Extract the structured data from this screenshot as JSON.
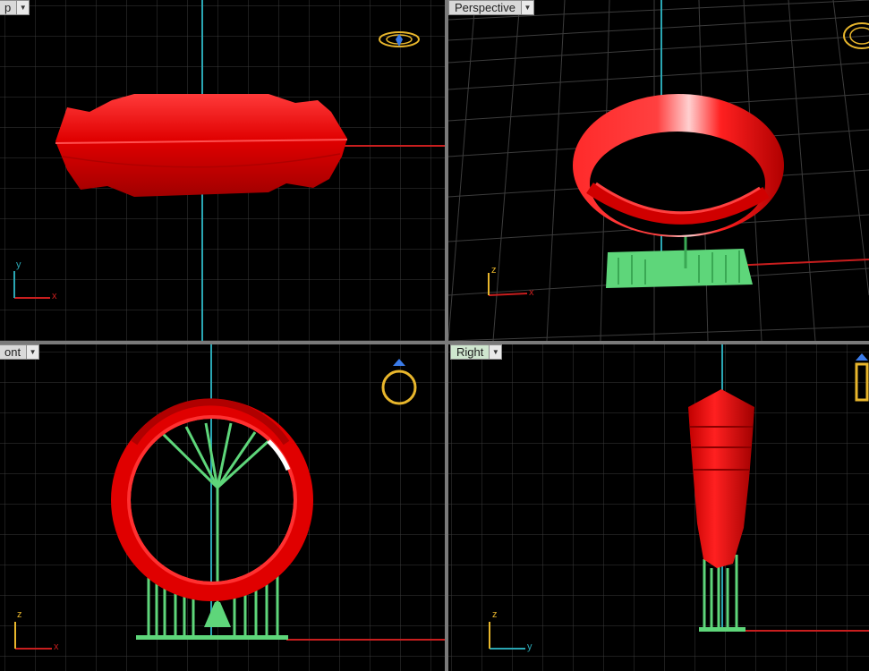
{
  "viewports": {
    "top": {
      "label": "p"
    },
    "perspective": {
      "label": "Perspective"
    },
    "front": {
      "label": "ont"
    },
    "right": {
      "label": "Right"
    }
  },
  "axes": {
    "top": {
      "a": "y",
      "b": "x"
    },
    "perspective": {
      "a": "z",
      "b": "x"
    },
    "front": {
      "a": "z",
      "b": "x"
    },
    "right": {
      "a": "z",
      "b": "y"
    }
  },
  "colors": {
    "background": "#000000",
    "grid": "#3c3c3c",
    "ring": "#ff1a1a",
    "supports": "#5ed67a",
    "axis_x": "#c81e1e",
    "axis_y": "#2aa6b3",
    "widget": "#e8b62c",
    "gem": "#3b7be8"
  },
  "icons": {
    "dropdown": "chevron-down-icon",
    "nav_widget": "ring-widget-icon"
  }
}
